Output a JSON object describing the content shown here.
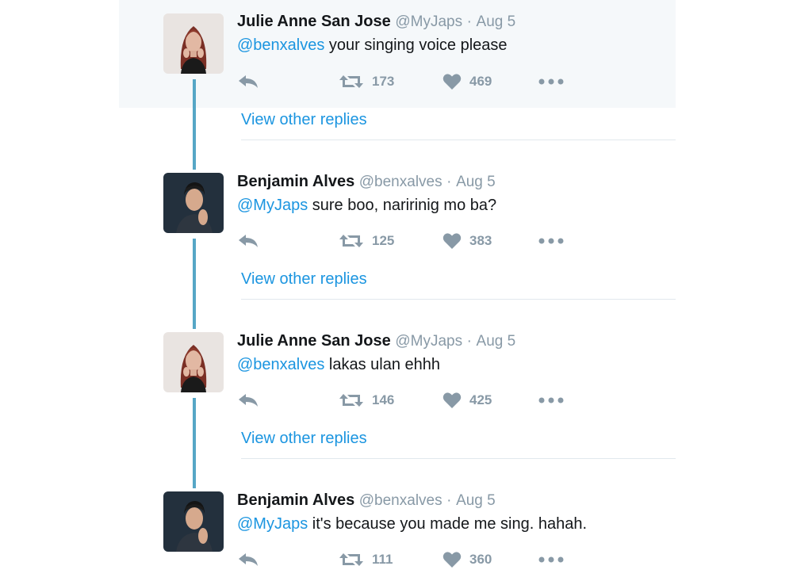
{
  "tweets": [
    {
      "name": "Julie Anne San Jose",
      "handle": "@MyJaps",
      "separator": "·",
      "date": "Aug 5",
      "mention": "@benxalves",
      "text": " your singing voice please",
      "retweets": "173",
      "likes": "469",
      "avatar": "female-portrait"
    },
    {
      "name": "Benjamin Alves",
      "handle": "@benxalves",
      "separator": "·",
      "date": "Aug 5",
      "mention": "@MyJaps",
      "text": " sure boo, naririnig mo ba?",
      "retweets": "125",
      "likes": "383",
      "avatar": "male-portrait"
    },
    {
      "name": "Julie Anne San Jose",
      "handle": "@MyJaps",
      "separator": "·",
      "date": "Aug 5",
      "mention": "@benxalves",
      "text": " lakas ulan ehhh",
      "retweets": "146",
      "likes": "425",
      "avatar": "female-portrait"
    },
    {
      "name": "Benjamin Alves",
      "handle": "@benxalves",
      "separator": "·",
      "date": "Aug 5",
      "mention": "@MyJaps",
      "text": " it's because you made me sing. hahah.",
      "retweets": "111",
      "likes": "360",
      "avatar": "male-portrait"
    }
  ],
  "view_other_replies": "View other replies",
  "icons": {
    "reply": "reply-icon",
    "retweet": "retweet-icon",
    "like": "heart-icon",
    "more": "more-dots-icon"
  },
  "colors": {
    "link": "#1b95e0",
    "muted": "#8899a6",
    "thread_line": "#56a6c6",
    "highlight_bg": "#f5f8fa"
  }
}
